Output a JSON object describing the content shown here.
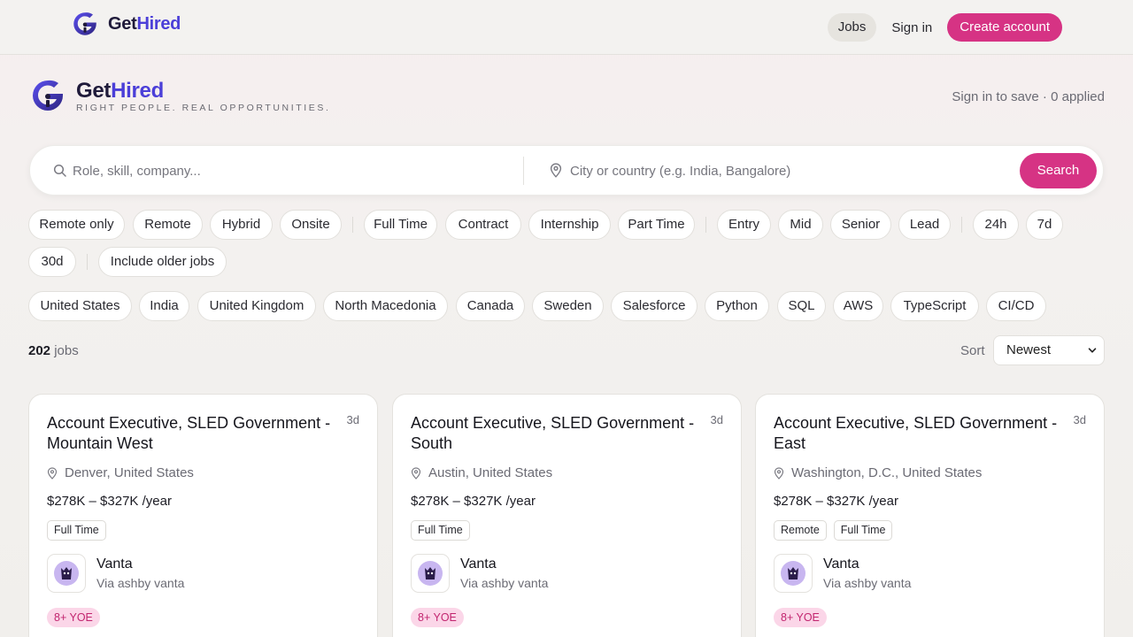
{
  "nav": {
    "brand_get": "Get",
    "brand_hired": "Hired",
    "jobs": "Jobs",
    "sign_in": "Sign in",
    "create_account": "Create account"
  },
  "hero": {
    "brand_get": "Get",
    "brand_hired": "Hired",
    "tagline": "RIGHT PEOPLE. REAL OPPORTUNITIES.",
    "status": "Sign in to save · 0 applied"
  },
  "search": {
    "role_placeholder": "Role, skill, company...",
    "location_placeholder": "City or country (e.g. India, Bangalore)",
    "button": "Search"
  },
  "filters": {
    "work_mode": [
      "Remote only",
      "Remote",
      "Hybrid",
      "Onsite"
    ],
    "job_type": [
      "Full Time",
      "Contract",
      "Internship",
      "Part Time"
    ],
    "level": [
      "Entry",
      "Mid",
      "Senior",
      "Lead"
    ],
    "posted": [
      "24h",
      "7d",
      "30d"
    ],
    "older": "Include older jobs",
    "quick": [
      "United States",
      "India",
      "United Kingdom",
      "North Macedonia",
      "Canada",
      "Sweden",
      "Salesforce",
      "Python",
      "SQL",
      "AWS",
      "TypeScript",
      "CI/CD"
    ]
  },
  "results": {
    "count": "202",
    "count_suffix": " jobs",
    "sort_label": "Sort",
    "sort_value": "Newest"
  },
  "jobs": [
    {
      "title": "Account Executive, SLED Government - Mountain West",
      "age": "3d",
      "location": "Denver, United States",
      "salary": "$278K – $327K /year",
      "tags": [
        "Full Time"
      ],
      "company": "Vanta",
      "via": "Via ashby vanta",
      "yoe": "8+ YOE"
    },
    {
      "title": "Account Executive, SLED Government - South",
      "age": "3d",
      "location": "Austin, United States",
      "salary": "$278K – $327K /year",
      "tags": [
        "Full Time"
      ],
      "company": "Vanta",
      "via": "Via ashby vanta",
      "yoe": "8+ YOE"
    },
    {
      "title": "Account Executive, SLED Government - East",
      "age": "3d",
      "location": "Washington, D.C., United States",
      "salary": "$278K – $327K /year",
      "tags": [
        "Remote",
        "Full Time"
      ],
      "company": "Vanta",
      "via": "Via ashby vanta",
      "yoe": "8+ YOE"
    }
  ],
  "colors": {
    "accent": "#d63384",
    "brand": "#4b3fd8",
    "yoe_bg": "#fbd6e8"
  }
}
